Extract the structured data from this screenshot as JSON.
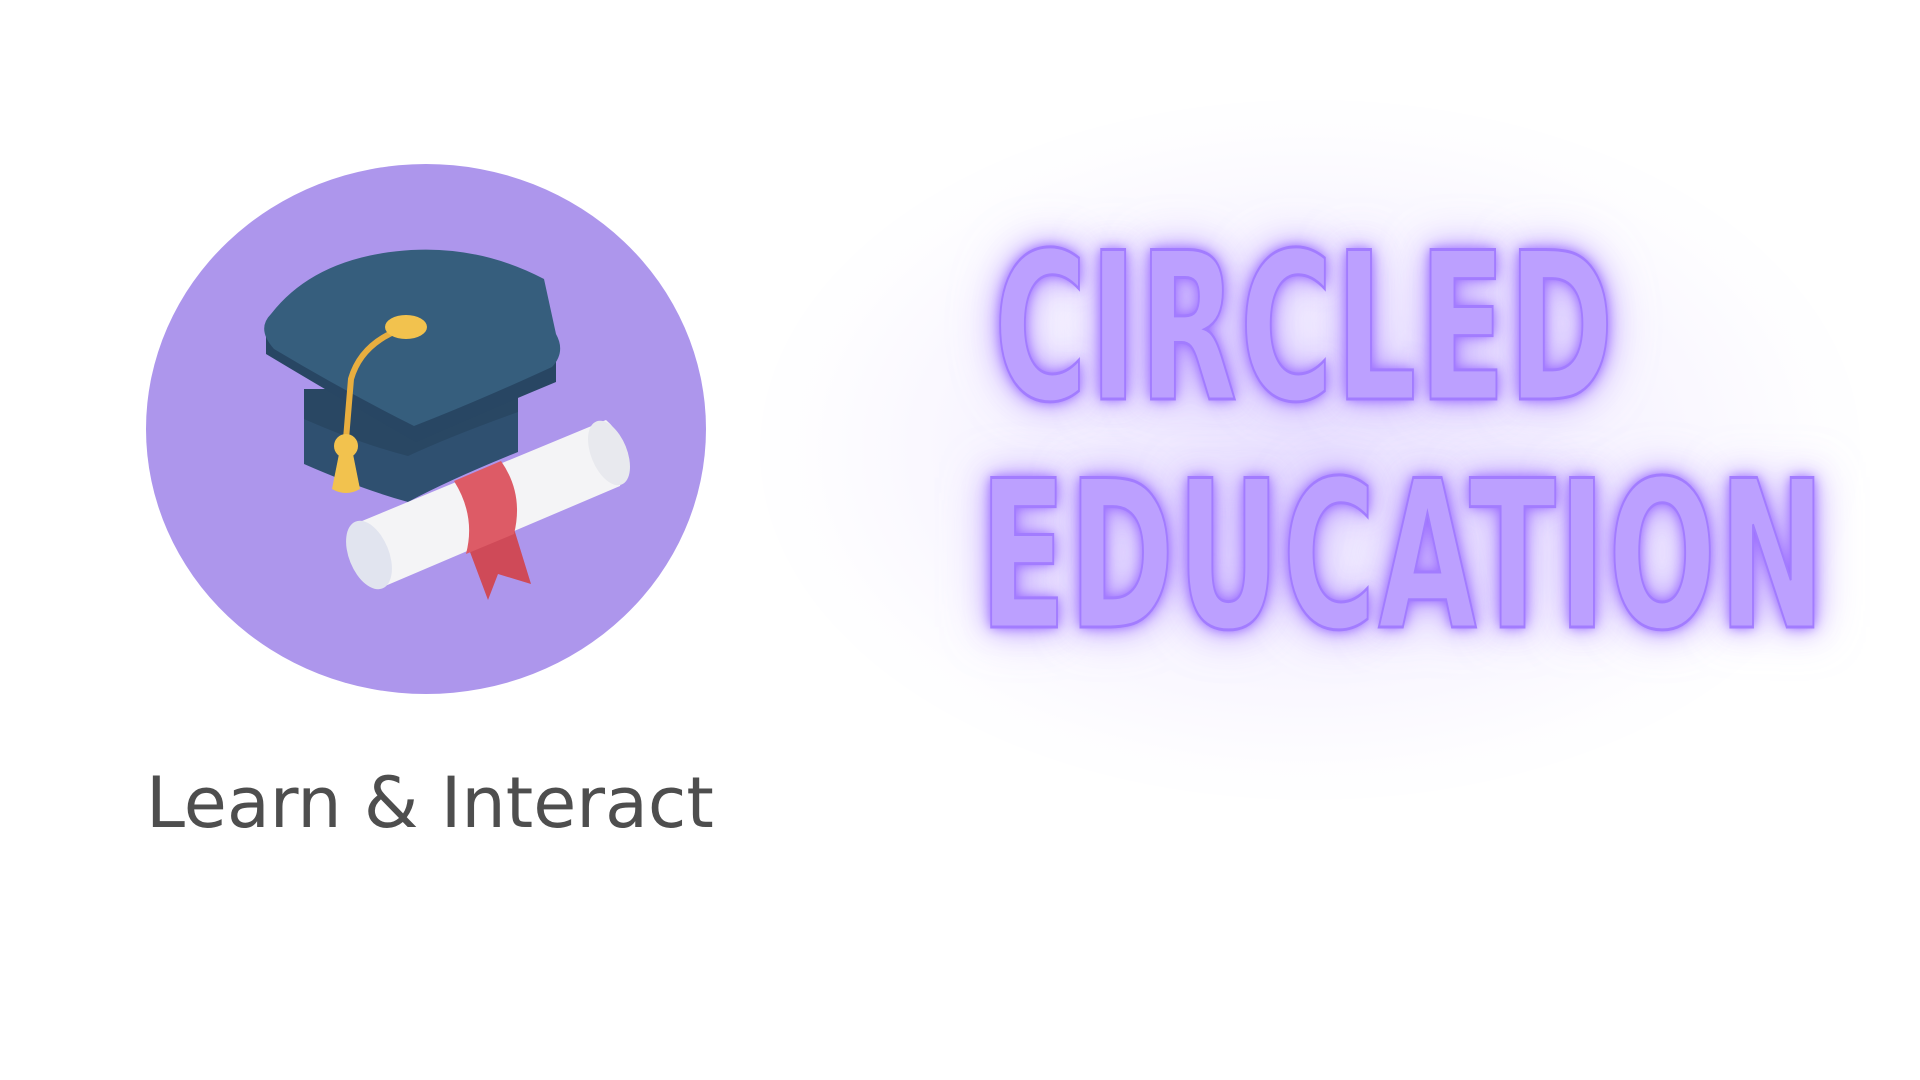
{
  "logo": {
    "icon": "graduation-cap-with-diploma-icon",
    "circle_color": "#ad96ec",
    "cap_color": "#355d7b",
    "tassel_color": "#f2c24e",
    "ribbon_color": "#dd5b66",
    "scroll_color": "#f4f4f6"
  },
  "tagline": "Learn & Interact",
  "headline": {
    "line1": "CIRCLED",
    "line2": "EDUCATION",
    "color": "#bca0ff",
    "glow_color": "#9a6bff"
  }
}
